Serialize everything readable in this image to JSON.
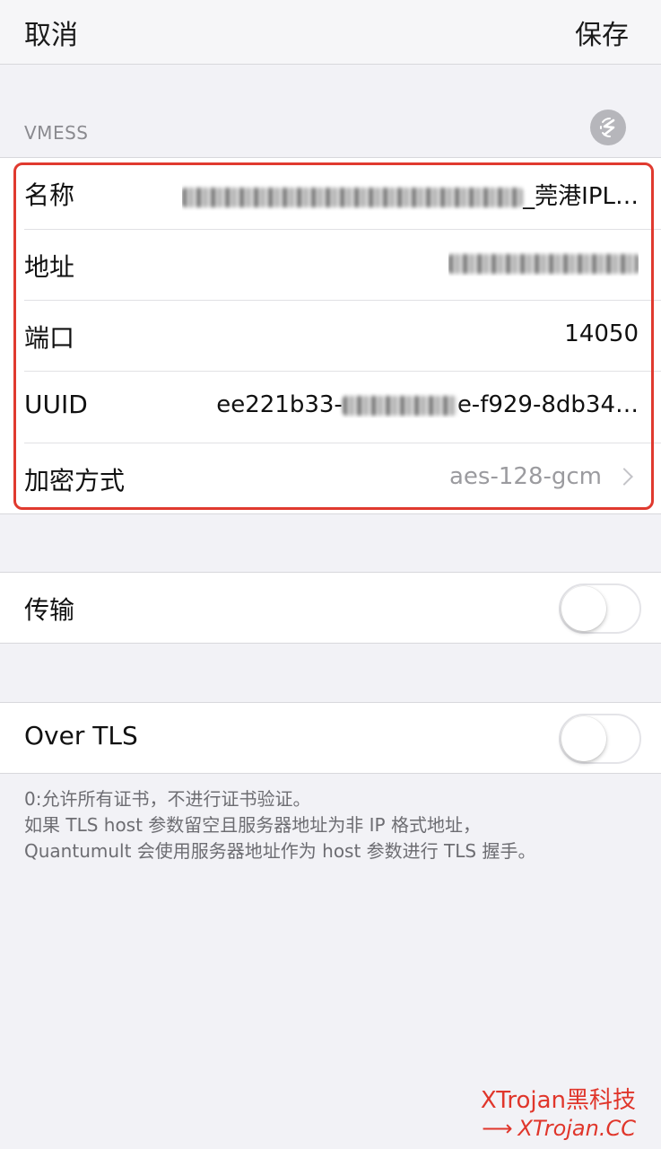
{
  "navbar": {
    "cancel_label": "取消",
    "save_label": "保存"
  },
  "section": {
    "header": "VMESS",
    "icon": "quantumult-icon"
  },
  "fields": {
    "name": {
      "label": "名称",
      "value_suffix": "_莞港IPL…"
    },
    "address": {
      "label": "地址"
    },
    "port": {
      "label": "端口",
      "value": "14050"
    },
    "uuid": {
      "label": "UUID",
      "value_prefix": "ee221b33-",
      "value_suffix": "e-f929-8db34…"
    },
    "encryption": {
      "label": "加密方式",
      "value": "aes-128-gcm"
    }
  },
  "transport": {
    "label": "传输",
    "enabled": false
  },
  "over_tls": {
    "label": "Over TLS",
    "enabled": false
  },
  "footnote": {
    "line1": "0:允许所有证书，不进行证书验证。",
    "line2": "如果 TLS host 参数留空且服务器地址为非 IP 格式地址，",
    "line3": "Quantumult 会使用服务器地址作为 host 参数进行 TLS 握手。"
  },
  "watermark": {
    "line1": "XTrojan黑科技",
    "line2": "XTrojan.CC"
  },
  "colors": {
    "highlight": "#e03a2f",
    "watermark": "#e0362b",
    "background": "#f2f2f6"
  }
}
